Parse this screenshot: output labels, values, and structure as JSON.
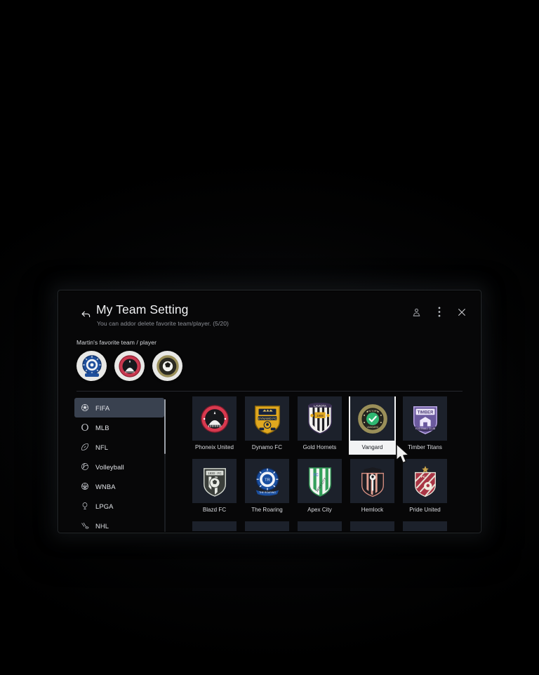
{
  "header": {
    "back_icon": "back-arrow-icon",
    "title": "My Team Setting",
    "subtitle": "You can addor delete favorite team/player. (5/20)",
    "actions": [
      {
        "name": "account-icon",
        "label": "Account"
      },
      {
        "name": "more-options-icon",
        "label": "More options"
      },
      {
        "name": "close-icon",
        "label": "Close"
      }
    ]
  },
  "favorites": {
    "label": "Martin's favorite team / player",
    "items": [
      {
        "name": "favorite-avatar-blue",
        "color": "#1f4f9c"
      },
      {
        "name": "favorite-avatar-red",
        "color": "#c8384f"
      },
      {
        "name": "favorite-avatar-gold",
        "color": "#9a8f59"
      }
    ]
  },
  "sidebar": {
    "selected": "FIFA",
    "items": [
      {
        "label": "FIFA",
        "icon": "soccer-ball-icon",
        "selected": true
      },
      {
        "label": "MLB",
        "icon": "baseball-icon",
        "selected": false
      },
      {
        "label": "NFL",
        "icon": "football-icon",
        "selected": false
      },
      {
        "label": "Volleyball",
        "icon": "volleyball-icon",
        "selected": false
      },
      {
        "label": "WNBA",
        "icon": "basketball-icon",
        "selected": false
      },
      {
        "label": "LPGA",
        "icon": "golf-icon",
        "selected": false
      },
      {
        "label": "NHL",
        "icon": "hockey-icon",
        "selected": false
      }
    ]
  },
  "teams": {
    "rows": [
      [
        {
          "name": "Phoneix United",
          "logo": "crest-circle-red",
          "selected": false
        },
        {
          "name": "Dynamo FC",
          "logo": "shield-gold",
          "selected": false
        },
        {
          "name": "Gold Hornets",
          "logo": "shield-white-stripe",
          "selected": false
        },
        {
          "name": "Vangard",
          "logo": "badge-gold-check",
          "selected": true
        },
        {
          "name": "Timber Titans",
          "logo": "shield-purple",
          "selected": false
        }
      ],
      [
        {
          "name": "Blazd FC",
          "logo": "shield-gray-ball",
          "selected": false
        },
        {
          "name": "The Roaring",
          "logo": "crest-circle-blue",
          "selected": false
        },
        {
          "name": "Apex City",
          "logo": "shield-green",
          "selected": false
        },
        {
          "name": "Hemlock",
          "logo": "shield-crown-salmon",
          "selected": false
        },
        {
          "name": "Pride United",
          "logo": "shield-crimson-star",
          "selected": false
        }
      ],
      [
        {
          "name": "",
          "logo": "shield-partial",
          "selected": false
        },
        {
          "name": "",
          "logo": "shield-partial",
          "selected": false
        },
        {
          "name": "",
          "logo": "shield-partial",
          "selected": false
        },
        {
          "name": "",
          "logo": "shield-partial",
          "selected": false
        },
        {
          "name": "",
          "logo": "shield-partial",
          "selected": false
        }
      ]
    ]
  },
  "colors": {
    "accent_selected": "#39414f",
    "card_bg": "#1c212b",
    "screen_bg": "#070708",
    "check_green": "#2eb872",
    "highlight": "#f2f3f4"
  }
}
